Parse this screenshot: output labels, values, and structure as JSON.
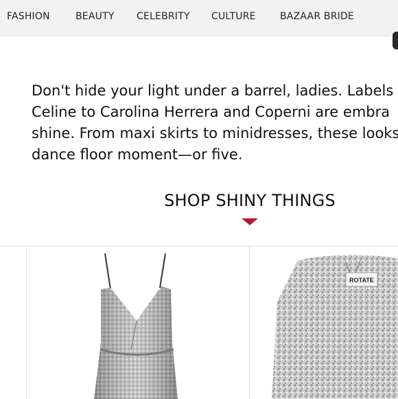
{
  "nav": {
    "items": [
      "FASHION",
      "BEAUTY",
      "CELEBRITY",
      "CULTURE",
      "BAZAAR BRIDE"
    ]
  },
  "article": {
    "intro_lines": [
      "Don't hide your light under a barrel, ladies. Labels f",
      "Celine to Carolina Herrera and Coperni are embra",
      "shine. From maxi skirts to minidresses, these looks c",
      "dance floor moment—or five."
    ]
  },
  "shop": {
    "heading": "SHOP SHINY THINGS",
    "arrow_color": "#b01c2e"
  },
  "products": {
    "items": [
      {
        "label_text": ""
      },
      {
        "label_text": ""
      },
      {
        "label_text": "ROTATE"
      }
    ]
  },
  "colors": {
    "nav_bg": "#f2f2f2",
    "accent": "#b01c2e",
    "text": "#111111"
  }
}
